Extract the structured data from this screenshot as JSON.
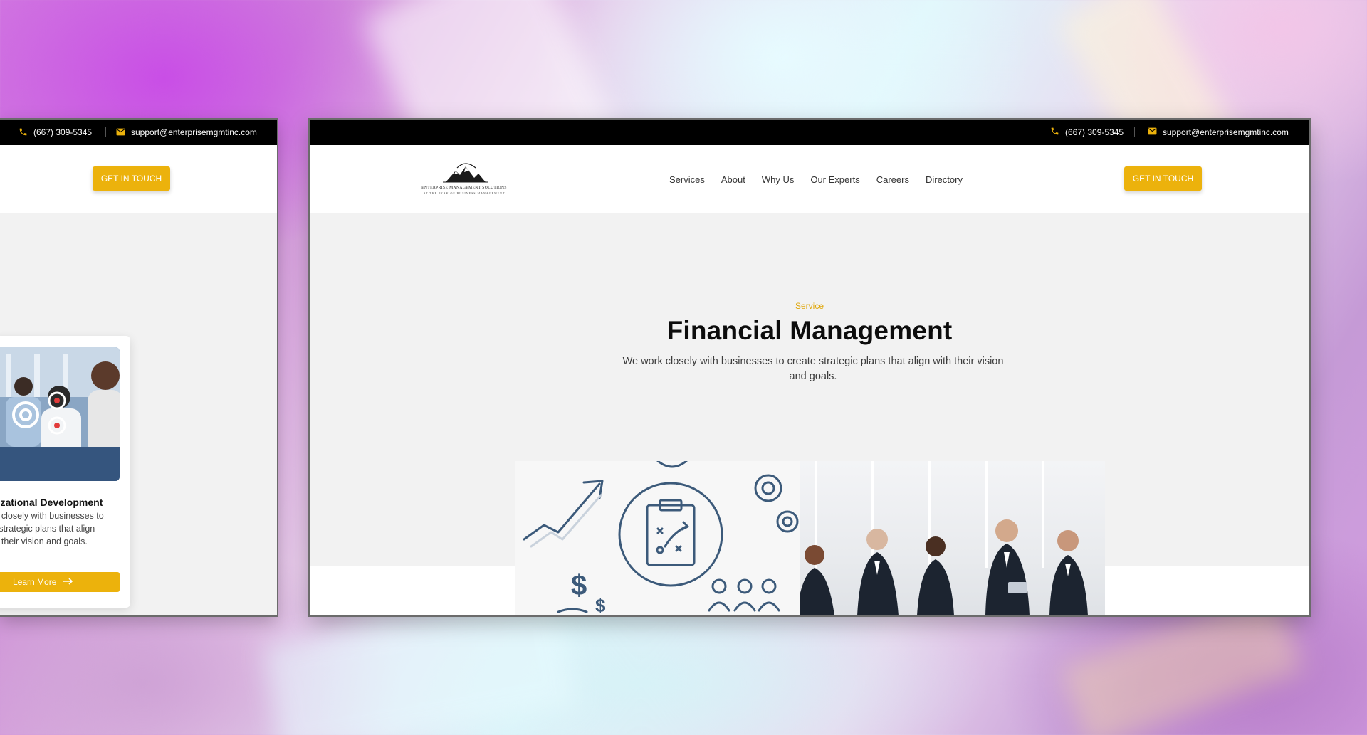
{
  "left_window": {
    "phone": "(667) 309-5345",
    "email": "support@enterprisemgmtinc.com",
    "cta_label": "GET IN TOUCH",
    "card": {
      "title": "nizational Development",
      "text": "rk closely with businesses to\ne strategic plans that align\nth their vision and goals.",
      "button_label": "Learn More"
    }
  },
  "main_window": {
    "topbar": {
      "phone": "(667) 309-5345",
      "email": "support@enterprisemgmtinc.com"
    },
    "logo": {
      "name": "ENTERPRISE MANAGEMENT SOLUTIONS",
      "tagline": "AT THE PEAK OF BUSINESS MANAGEMENT"
    },
    "nav": {
      "items": [
        "Services",
        "About",
        "Why Us",
        "Our Experts",
        "Careers",
        "Directory"
      ]
    },
    "cta_label": "GET IN TOUCH",
    "hero": {
      "kicker": "Service",
      "title": "Financial Management",
      "description": "We work closely with businesses to create strategic plans that align with their vision and goals."
    }
  },
  "icons": [
    "phone-icon",
    "mail-icon",
    "arrow-right-icon",
    "mountain-logo-icon"
  ],
  "colors": {
    "accent": "#ecb20c",
    "topbar": "#000000",
    "page_bg": "#f2f2f2",
    "title": "#0c0c0c"
  }
}
